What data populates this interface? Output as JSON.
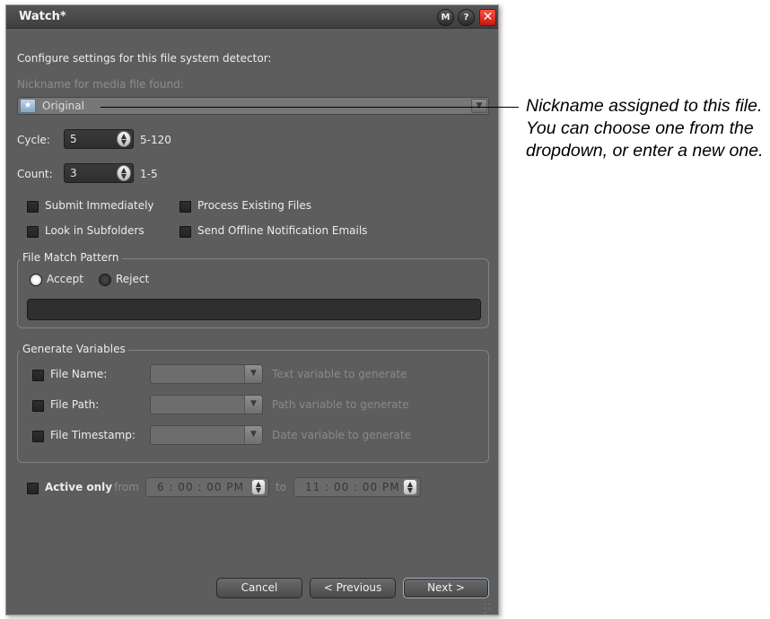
{
  "window": {
    "title": "Watch*",
    "help_buttons": [
      "M",
      "?"
    ],
    "close_glyph": "✕"
  },
  "intro_text": "Configure settings for this file system detector:",
  "nickname": {
    "label": "Nickname for media file found:",
    "value": "Original",
    "icon": "media-file-icon",
    "arrow": "chevron-down-icon"
  },
  "cycle": {
    "label": "Cycle:",
    "value": "5",
    "range": "5-120"
  },
  "count": {
    "label": "Count:",
    "value": "3",
    "range": "1-5"
  },
  "options": {
    "submit_immediately": "Submit Immediately",
    "process_existing": "Process Existing Files",
    "look_in_subfolders": "Look in Subfolders",
    "send_offline": "Send Offline Notification Emails"
  },
  "file_match": {
    "title": "File Match Pattern",
    "accept": "Accept",
    "reject": "Reject",
    "selected": "Accept",
    "pattern_value": ""
  },
  "generate_variables": {
    "title": "Generate Variables",
    "rows": [
      {
        "label": "File Name:",
        "placeholder": "Text variable to generate"
      },
      {
        "label": "File Path:",
        "placeholder": "Path variable to generate"
      },
      {
        "label": "File Timestamp:",
        "placeholder": "Date variable to generate"
      }
    ]
  },
  "active": {
    "label": "Active only",
    "from_label": "from",
    "from_value": "6 : 00 : 00  PM",
    "to_label": "to",
    "to_value": "11 : 00 : 00  PM"
  },
  "buttons": {
    "cancel": "Cancel",
    "previous": "< Previous",
    "next": "Next >"
  },
  "callout": "Nickname assigned to this file. You can choose one from the dropdown, or enter a new one.",
  "colors": {
    "window_bg": "#5d5d5d",
    "title_bg": "#474747",
    "close_red": "#e3281c",
    "callout_text": "#000000"
  }
}
